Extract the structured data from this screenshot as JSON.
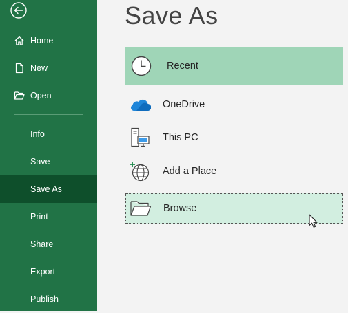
{
  "sidebar": {
    "items": [
      {
        "label": "Home",
        "icon": "home-icon"
      },
      {
        "label": "New",
        "icon": "new-document-icon"
      },
      {
        "label": "Open",
        "icon": "open-folder-icon"
      },
      {
        "label": "Info"
      },
      {
        "label": "Save"
      },
      {
        "label": "Save As",
        "selected": true
      },
      {
        "label": "Print"
      },
      {
        "label": "Share"
      },
      {
        "label": "Export"
      },
      {
        "label": "Publish"
      }
    ],
    "back_icon": "back-arrow-icon",
    "background_color": "#217346",
    "selected_color": "#0e4f2b"
  },
  "main": {
    "title": "Save As",
    "locations": [
      {
        "label": "Recent",
        "icon": "clock-icon",
        "selected": true
      },
      {
        "label": "OneDrive",
        "icon": "onedrive-cloud-icon"
      },
      {
        "label": "This PC",
        "icon": "this-pc-icon"
      },
      {
        "label": "Add a Place",
        "icon": "add-place-globe-icon"
      },
      {
        "label": "Browse",
        "icon": "browse-folder-icon",
        "hovered": true
      }
    ],
    "selected_color": "#9fd5b7",
    "hover_color": "#d2eee0"
  }
}
